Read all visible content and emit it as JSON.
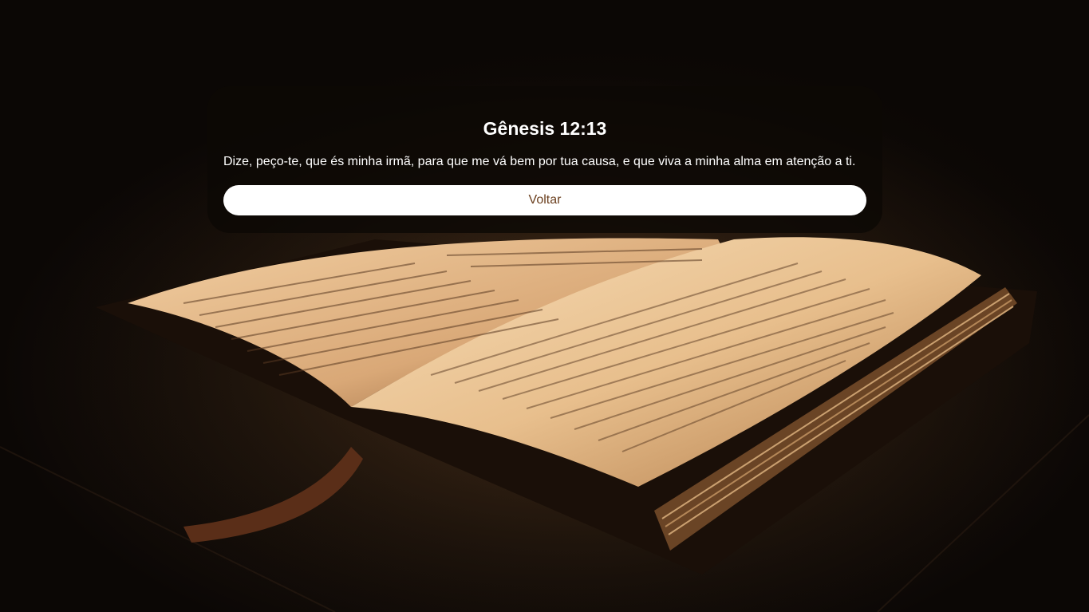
{
  "verse": {
    "reference": "Gênesis 12:13",
    "text": "Dize, peço-te, que és minha irmã, para que me vá bem por tua causa, e que viva a minha alma em atenção a ti."
  },
  "actions": {
    "back_label": "Voltar"
  },
  "colors": {
    "card_background": "#0c0805",
    "button_background": "#ffffff",
    "button_text": "#6b3f1e"
  }
}
